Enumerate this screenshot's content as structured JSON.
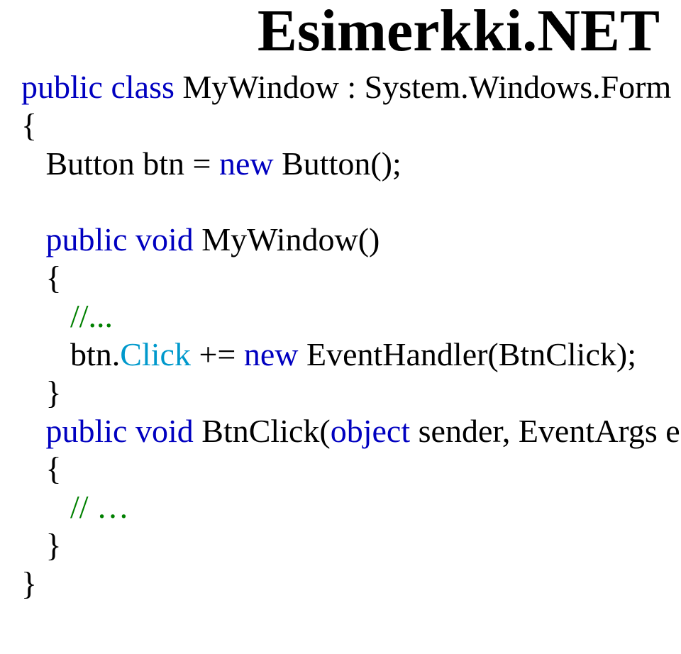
{
  "title": "Esimerkki.NET",
  "code": {
    "l1a": "public class",
    "l1b": " MyWindow : System.Windows.Form",
    "l2": "{",
    "l3a": "   Button btn = ",
    "l3b": "new",
    "l3c": " Button();",
    "blank1": "",
    "l4a": "   public void",
    "l4b": " MyWindow()",
    "l5": "   {",
    "l6": "      //...",
    "l7a": "      btn.",
    "l7b": "Click",
    "l7c": " += ",
    "l7d": "new",
    "l7e": " EventHandler(BtnClick);",
    "l8": "   }",
    "l9a": "   public void",
    "l9b": " BtnClick(",
    "l9c": "object",
    "l9d": " sender, EventArgs e)",
    "l10": "   {",
    "l11": "      // …",
    "l12": "   }",
    "l13": "}"
  }
}
